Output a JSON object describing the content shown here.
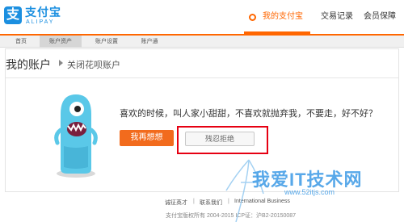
{
  "brand": {
    "logo_glyph": "支",
    "name_cn": "支付宝",
    "name_en": "ALIPAY",
    "color": "#1b8fe0"
  },
  "header": {
    "nav": [
      {
        "label": "我的支付宝",
        "active": true
      },
      {
        "label": "交易记录",
        "active": false
      },
      {
        "label": "会员保障",
        "active": false
      }
    ],
    "accent_color": "#ff6600"
  },
  "subnav": {
    "items": [
      {
        "label": "首页",
        "active": false
      },
      {
        "label": "账户资产",
        "active": true
      },
      {
        "label": "账户设置",
        "active": false
      },
      {
        "label": "账户通",
        "active": false
      }
    ]
  },
  "main": {
    "title": "我的账户",
    "breadcrumb": "关闭花呗账户",
    "message": "喜欢的时候，叫人家小甜甜，不喜欢就抛弃我，不要走，好不好？",
    "primary_button": "我再想想",
    "secondary_button": "残忍拒绝",
    "mascot_icon": "blue-monster-mascot-icon",
    "highlight_color": "#e60012"
  },
  "footer": {
    "links": [
      "诚征英才",
      "联系我们",
      "International Business"
    ],
    "separator": "|",
    "copyright": "支付宝版权所有 2004-2015 ICP证：沪B2-20150087"
  },
  "watermark": {
    "text": "我爱IT技术网",
    "url": "www.52itjs.com"
  }
}
